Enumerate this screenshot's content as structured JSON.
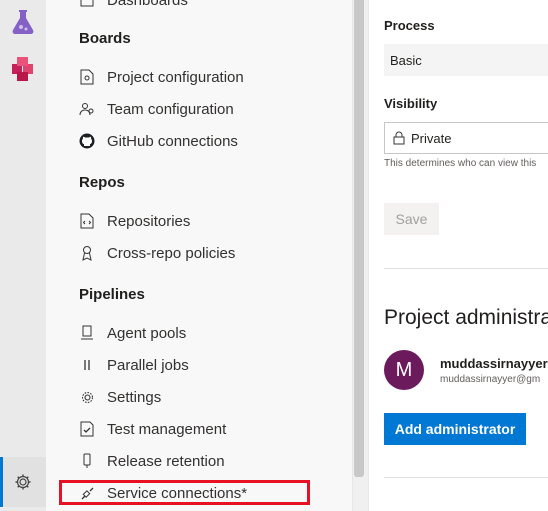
{
  "nav": {
    "partial_top_label": "Dashboards",
    "sections": {
      "boards": "Boards",
      "repos": "Repos",
      "pipelines": "Pipelines"
    },
    "boards_items": [
      "Project configuration",
      "Team configuration",
      "GitHub connections"
    ],
    "repos_items": [
      "Repositories",
      "Cross-repo policies"
    ],
    "pipelines_items": [
      "Agent pools",
      "Parallel jobs",
      "Settings",
      "Test management",
      "Release retention",
      "Service connections*"
    ]
  },
  "main": {
    "process_label": "Process",
    "process_value": "Basic",
    "visibility_label": "Visibility",
    "visibility_value": "Private",
    "visibility_help": "This determines who can view this",
    "save_label": "Save",
    "admin_heading": "Project administra",
    "admin": {
      "avatar_initial": "M",
      "name": "muddassirnayyer",
      "email": "muddassirnayyer@gm"
    },
    "add_admin_label": "Add administrator"
  },
  "colors": {
    "accent": "#0078d4",
    "highlight_box": "#e81123",
    "avatar": "#6b1a5b"
  }
}
